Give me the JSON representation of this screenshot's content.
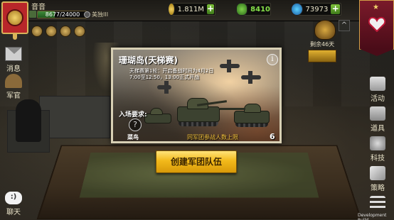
{
  "player": {
    "name": "音音",
    "xp": "8677/24000",
    "xp_progress": 0.36,
    "alliance": "美独III"
  },
  "resources": {
    "gold": "1.811M",
    "oil": "8410",
    "gems": "73973"
  },
  "event": {
    "days_left": "剩余46天"
  },
  "left_menu": {
    "mail": "消息",
    "officer": "军官",
    "chat": "聊天",
    "chat_symbol": ":)"
  },
  "right_menu": {
    "activity": "活动",
    "shop": "道具",
    "tech": "科技",
    "strategy": "策略"
  },
  "dialog": {
    "title": "珊瑚岛(天梯赛)",
    "info": "i",
    "description": "天梯赛第1轮：开启备战时间为4月2日7:00至12:50，13:00正式开战",
    "requirement_label": "入场要求:",
    "requirement_icon": "?",
    "rank": "菜鸟",
    "limit_label": "同军团参战人数上限",
    "limit_value": "6"
  },
  "buttons": {
    "create_team": "创建军团队伍",
    "plus": "+",
    "collapse": "^"
  },
  "footer": {
    "dev_build": "Development Build"
  },
  "colors": {
    "accent_gold": "#f2b91a",
    "limit_text": "#f2c23a",
    "oil_green": "#86e04a"
  }
}
